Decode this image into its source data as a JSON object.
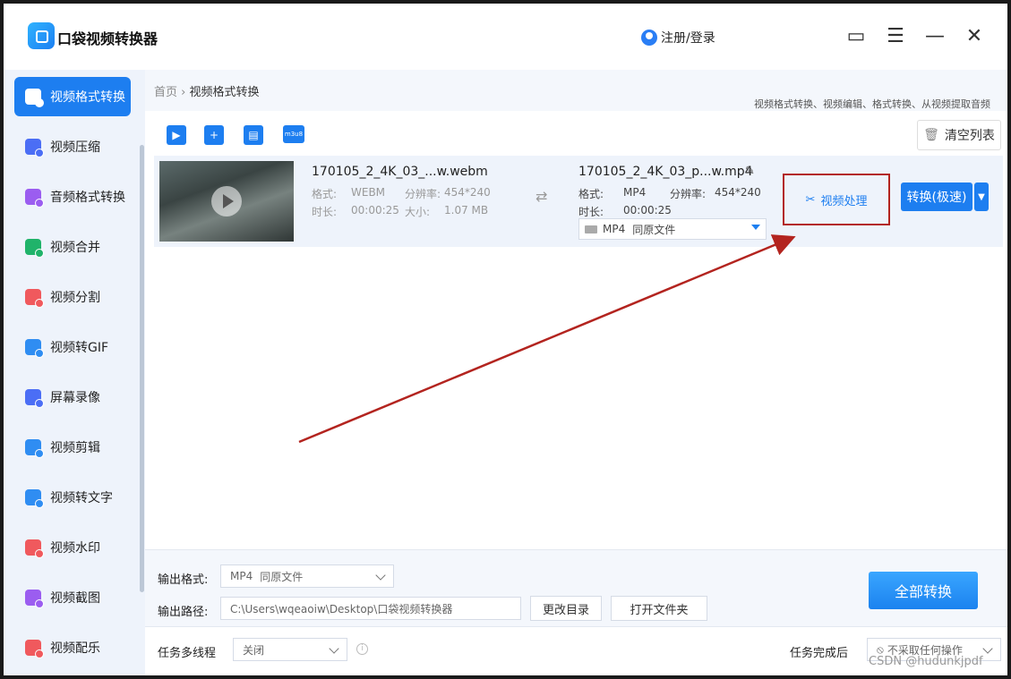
{
  "app": {
    "title": "口袋视频转换器",
    "login": "注册/登录"
  },
  "window_controls": [
    {
      "icon": "folder-icon",
      "glyph": "▭"
    },
    {
      "icon": "menu-icon",
      "glyph": "☰"
    },
    {
      "icon": "minimize-icon",
      "glyph": "—"
    },
    {
      "icon": "close-icon",
      "glyph": "✕"
    }
  ],
  "sidebar": {
    "items": [
      {
        "label": "视频格式转换",
        "active": true,
        "color": "#ffffff"
      },
      {
        "label": "视频压缩",
        "color": "#4b6ef5"
      },
      {
        "label": "音频格式转换",
        "color": "#9b5df0"
      },
      {
        "label": "视频合并",
        "color": "#20b36a"
      },
      {
        "label": "视频分割",
        "color": "#f0595d"
      },
      {
        "label": "视频转GIF",
        "color": "#2f8df2"
      },
      {
        "label": "屏幕录像",
        "color": "#4b6ef5"
      },
      {
        "label": "视频剪辑",
        "color": "#2f8df2"
      },
      {
        "label": "视频转文字",
        "color": "#2f8df2"
      },
      {
        "label": "视频水印",
        "color": "#f0595d"
      },
      {
        "label": "视频截图",
        "color": "#9b5df0"
      },
      {
        "label": "视频配乐",
        "color": "#f0595d"
      }
    ]
  },
  "breadcrumb": {
    "home": "首页",
    "separator": "›",
    "current": "视频格式转换"
  },
  "promo_text": "视频格式转换、视频编辑、格式转换、从视频提取音频",
  "toolbar": {
    "add_file_icon": "add-file-icon",
    "add_folder_icon": "add-folder-icon",
    "add_device_icon": "add-device-icon",
    "m3u8_label": "m3u8",
    "clear_list": "清空列表"
  },
  "file": {
    "source": {
      "name": "170105_2_4K_03_...w.webm",
      "format_label": "格式:",
      "format": "WEBM",
      "resolution_label": "分辨率:",
      "resolution": "454*240",
      "duration_label": "时长:",
      "duration": "00:00:25",
      "size_label": "大小:",
      "size": "1.07 MB"
    },
    "output": {
      "name": "170105_2_4K_03_p...w.mp4",
      "format_label": "格式:",
      "format": "MP4",
      "resolution_label": "分辨率:",
      "resolution": "454*240",
      "duration_label": "时长:",
      "duration": "00:00:25",
      "preset": "MP4",
      "preset_quality": "同原文件"
    },
    "process_button": "视频处理",
    "convert_button": "转换(极速)"
  },
  "bottom": {
    "output_format_label": "输出格式:",
    "output_format_value": "MP4",
    "output_format_quality": "同原文件",
    "output_path_label": "输出路径:",
    "output_path_value": "C:\\Users\\wqeaoiw\\Desktop\\口袋视频转换器",
    "change_dir": "更改目录",
    "open_folder": "打开文件夹",
    "convert_all": "全部转换"
  },
  "footer": {
    "multithread_label": "任务多线程",
    "multithread_value": "关闭",
    "after_done_label": "任务完成后",
    "after_done_value": "不采取任何操作"
  },
  "watermark": "CSDN @hudunkjpdf",
  "annotation_color": "#b3241f"
}
